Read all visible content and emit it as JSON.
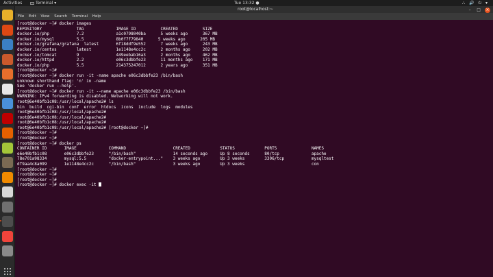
{
  "topbar": {
    "activities": "Activities",
    "app_name": "Terminal ▾",
    "clock": "Tue 13:32 ●",
    "tray": "⛬ 🔊 ⏻ ▾"
  },
  "window": {
    "title": "root@localhost:~",
    "controls": {
      "minimize": "–",
      "maximize": "□",
      "close": "×"
    }
  },
  "menubar": [
    "File",
    "Edit",
    "View",
    "Search",
    "Terminal",
    "Help"
  ],
  "dock": [
    {
      "name": "chrome-icon",
      "color": "#e8b02a"
    },
    {
      "name": "ubuntu-icon",
      "color": "#dd4814"
    },
    {
      "name": "libreoffice-writer-icon",
      "color": "#3b7fc4"
    },
    {
      "name": "libreoffice-impress-icon",
      "color": "#c9592c"
    },
    {
      "name": "ubuntu-software-icon",
      "color": "#e86e2c"
    },
    {
      "name": "amazon-icon",
      "color": "#e7e7e7"
    },
    {
      "name": "help-icon",
      "color": "#4a90d9"
    },
    {
      "name": "filezilla-icon",
      "color": "#bf0000"
    },
    {
      "name": "firefox-icon",
      "color": "#e66000"
    },
    {
      "name": "android-icon",
      "color": "#a4c639"
    },
    {
      "name": "files-icon",
      "color": "#7a6a53"
    },
    {
      "name": "vlc-icon",
      "color": "#f08a00"
    },
    {
      "name": "text-editor-icon",
      "color": "#d8d8d8"
    },
    {
      "name": "screenshot-icon",
      "color": "#707070"
    },
    {
      "name": "terminal-icon",
      "color": "#4d4d4d"
    },
    {
      "name": "anydesk-icon",
      "color": "#ef443b"
    },
    {
      "name": "disk-icon",
      "color": "#8a8a8a"
    }
  ],
  "terminal": {
    "lines": [
      "[root@docker ~]# docker images",
      "REPOSITORY              TAG             IMAGE ID          CREATED          SIZE",
      "docker.io/php           7.2             a1c0798040ba      5 weeks ago      367 MB",
      "docker.io/mysql         5.5             8b0f7f79840      5 weeks ago      205 MB",
      "docker.io/grafana/grafana  latest       6f18ddf9e552      7 weeks ago      243 MB",
      "docker.io/centos        latest          1e1148e4cc2c      2 months ago     202 MB",
      "docker.io/tomcat        9               449eebab16a3      2 months ago     462 MB",
      "docker.io/httpd         2.2             e06c3dbbfe23      11 months ago    171 MB",
      "docker.io/php           5.5             214375247012      2 years ago      351 MB",
      "[root@docker ~]#",
      "[root@docker ~]# docker run -it -name apache e06c3dbbfe23 /bin/bash",
      "unknown shorthand flag: 'n' in -name",
      "See 'docker run --help'.",
      "[root@docker ~]# docker run -it --name apache e06c3dbbfe23 /bin/bash",
      "WARNING: IPv4 forwarding is disabled. Networking will not work.",
      "root@6e40bfb1c08:/usr/local/apache2# ls",
      "bin  build  cgi-bin  conf  error  htdocs  icons  include  logs  modules",
      "root@6e40bfb1c08:/usr/local/apache2#",
      "root@6e40bfb1c08:/usr/local/apache2#",
      "root@6e40bfb1c08:/usr/local/apache2#",
      "root@6e40bfb1c08:/usr/local/apache2# [root@docker ~]#",
      "[root@docker ~]#",
      "[root@docker ~]#",
      "[root@docker ~]# docker ps",
      "CONTAINER ID       IMAGE             COMMAND                   CREATED            STATUS            PORTS              NAMES",
      "e6e40bfb1c08       e06c3dbbfe23      \"/bin/bash\"               14 seconds ago     Up 8 seconds      80/tcp             apache",
      "78e701a98334       mysql:5.5         \"docker-entrypoint...\"    3 weeks ago        Up 3 weeks        3306/tcp           mysqltest",
      "df9aa4c8a099       1e1148e4cc2c      \"/bin/bash\"               3 weeks ago        Up 3 weeks                           con",
      "[root@docker ~]#",
      "[root@docker ~]#",
      "[root@docker ~]#",
      "[root@docker ~]# docker exec -it "
    ]
  }
}
